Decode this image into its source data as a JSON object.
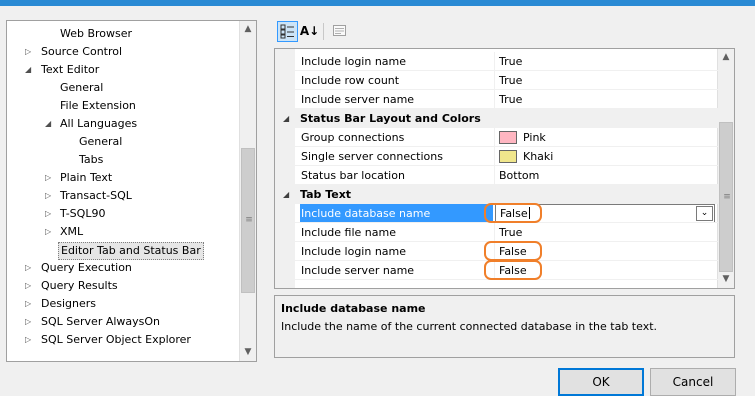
{
  "tree": {
    "items": [
      {
        "label": "Web Browser",
        "level": 1,
        "expander": ""
      },
      {
        "label": "Source Control",
        "level": 0,
        "expander": "▷"
      },
      {
        "label": "Text Editor",
        "level": 0,
        "expander": "◢"
      },
      {
        "label": "General",
        "level": 1,
        "expander": ""
      },
      {
        "label": "File Extension",
        "level": 1,
        "expander": ""
      },
      {
        "label": "All Languages",
        "level": 1,
        "expander": "◢"
      },
      {
        "label": "General",
        "level": 2,
        "expander": ""
      },
      {
        "label": "Tabs",
        "level": 2,
        "expander": ""
      },
      {
        "label": "Plain Text",
        "level": 1,
        "expander": "▷"
      },
      {
        "label": "Transact-SQL",
        "level": 1,
        "expander": "▷"
      },
      {
        "label": "T-SQL90",
        "level": 1,
        "expander": "▷"
      },
      {
        "label": "XML",
        "level": 1,
        "expander": "▷"
      },
      {
        "label": "Editor Tab and Status Bar",
        "level": 1,
        "expander": "",
        "selected": true
      },
      {
        "label": "Query Execution",
        "level": 0,
        "expander": "▷"
      },
      {
        "label": "Query Results",
        "level": 0,
        "expander": "▷"
      },
      {
        "label": "Designers",
        "level": 0,
        "expander": "▷"
      },
      {
        "label": "SQL Server AlwaysOn",
        "level": 0,
        "expander": "▷"
      },
      {
        "label": "SQL Server Object Explorer",
        "level": 0,
        "expander": "▷"
      }
    ]
  },
  "toolbar": {
    "categorized_icon": "categorized-icon",
    "alphabetical_icon": "alphabetical-sort-icon",
    "alphabetical_glyph": "A↓",
    "property_pages_icon": "property-pages-icon"
  },
  "grid": {
    "rows": [
      {
        "type": "prop",
        "name": "Include login name",
        "value": "True"
      },
      {
        "type": "prop",
        "name": "Include row count",
        "value": "True"
      },
      {
        "type": "prop",
        "name": "Include server name",
        "value": "True"
      },
      {
        "type": "category",
        "name": "Status Bar Layout and Colors"
      },
      {
        "type": "prop",
        "name": "Group connections",
        "value": "Pink",
        "swatch": "#ffb6c1"
      },
      {
        "type": "prop",
        "name": "Single server connections",
        "value": "Khaki",
        "swatch": "#f0e68c"
      },
      {
        "type": "prop",
        "name": "Status bar location",
        "value": "Bottom"
      },
      {
        "type": "category",
        "name": "Tab Text"
      },
      {
        "type": "prop",
        "name": "Include database name",
        "value": "False",
        "selected": true,
        "highlighted": true
      },
      {
        "type": "prop",
        "name": "Include file name",
        "value": "True"
      },
      {
        "type": "prop",
        "name": "Include login name",
        "value": "False",
        "highlighted": true
      },
      {
        "type": "prop",
        "name": "Include server name",
        "value": "False",
        "highlighted": true
      }
    ]
  },
  "description": {
    "title": "Include database name",
    "text": "Include the name of the current connected database in the tab text."
  },
  "buttons": {
    "ok": "OK",
    "cancel": "Cancel"
  },
  "colors": {
    "selection": "#3399ff",
    "highlight_outline": "#f07f2a",
    "default_button_border": "#0078d7"
  }
}
